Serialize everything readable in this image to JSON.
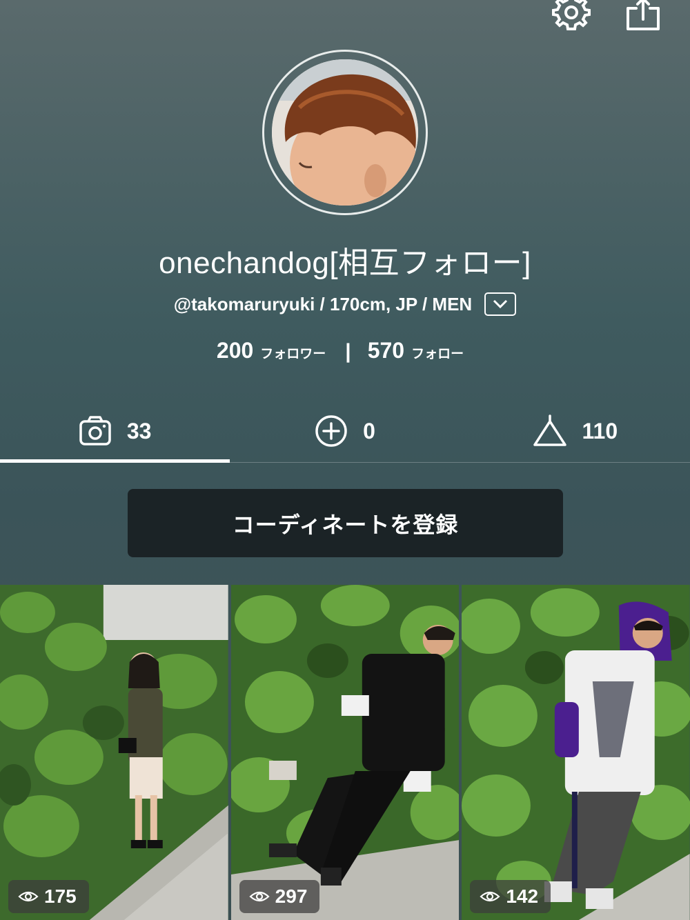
{
  "header": {
    "settings_icon": "gear-icon",
    "share_icon": "share-icon"
  },
  "profile": {
    "display_name": "onechandog[相互フォロー]",
    "meta": "@takomaruryuki / 170cm, JP / MEN",
    "followers_count": "200",
    "followers_label": "フォロワー",
    "following_count": "570",
    "following_label": "フォロー"
  },
  "tabs": [
    {
      "icon": "camera-icon",
      "count": "33"
    },
    {
      "icon": "plus-circle-icon",
      "count": "0"
    },
    {
      "icon": "hanger-icon",
      "count": "110"
    }
  ],
  "register_button": "コーディネートを登録",
  "photos": [
    {
      "views": "175"
    },
    {
      "views": "297"
    },
    {
      "views": "142"
    }
  ]
}
